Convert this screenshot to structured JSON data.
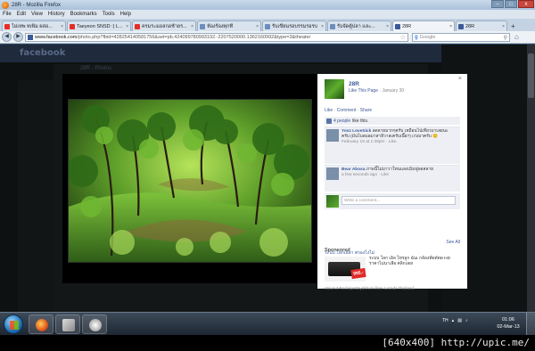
{
  "window": {
    "title": "28R - Mozilla Firefox",
    "controls": {
      "minimize": "–",
      "maximize": "□",
      "close": "x"
    }
  },
  "menu": [
    "File",
    "Edit",
    "View",
    "History",
    "Bookmarks",
    "Tools",
    "Help"
  ],
  "tabs": [
    {
      "label": "ไม่เทพ ทเพิ่ม ผล่อ...",
      "icon": "youtube-icon"
    },
    {
      "label": "Taeyeon SNSD :) L...",
      "icon": "youtube-icon"
    },
    {
      "label": "ครมระมอลกอช้ายร...",
      "icon": "youtube-icon"
    },
    {
      "label": "ห้องร้องทุกที่",
      "icon": "page-icon"
    },
    {
      "label": "รับเขียนรอบรรมรอรบ",
      "icon": "page-icon"
    },
    {
      "label": "รับจัดตู้ปลา และ...",
      "icon": "page-icon"
    },
    {
      "label": "28R",
      "icon": "facebook-icon",
      "active": true
    },
    {
      "label": "28R",
      "icon": "facebook-icon"
    }
  ],
  "nav": {
    "url_host": "www.facebook.com",
    "url_path": "/photo.php?fbid=428254140581756&set=pb.424099780993192.-2207520000.1362160992&type=3&theater",
    "search_placeholder": "Google"
  },
  "background_page": {
    "logo": "facebook",
    "title": "28R - Photos"
  },
  "panel": {
    "close": "×",
    "page_name": "28R",
    "like_page": "Like This Page",
    "date": "January 30",
    "actions": [
      "Like",
      "Comment",
      "Share"
    ],
    "likes": {
      "count": "4 people",
      "suffix": "like this."
    },
    "comments": [
      {
        "name": "Yosz LoveSick",
        "text": "ลดลายมากๆครับ เหมือนไปเที่ยวมาเลยนะครับ (มันไบลมอมาสาลีวาลเครับเนี๊ย?) เก่งมาครับ 😊",
        "time": "February 16 at 1:38pm · Like"
      },
      {
        "name": "Bear Abosa",
        "text": "ภาพนี้ไม่มาวาโทนแลงเมิมฟูลอสลาย",
        "time": "a few seconds ago · Like"
      }
    ],
    "write_placeholder": "Write a comment...",
    "sponsored": "Sponsored",
    "see_all": "See All",
    "ad": {
      "title": "ระบบ โลกเอิลา ตรองไงไม่",
      "text": "ระบบ โลก เอิล โทรลูก ฉันเ กล้องทั่ดดัตด HD ราคาไม่นาเลือ คลิกเลย!",
      "price": "995.-",
      "social": "Vasarut Rachapattayakhom likes Lazada Thailand."
    }
  },
  "taskbar": {
    "lang": "TH",
    "time": "01:06",
    "date": "02-Mar-13"
  },
  "caption": "[640x400] http://upic.me/",
  "colors": {
    "facebook_blue": "#3b5998",
    "panel_bg": "#ffffff",
    "stage_bg": "#000000"
  }
}
